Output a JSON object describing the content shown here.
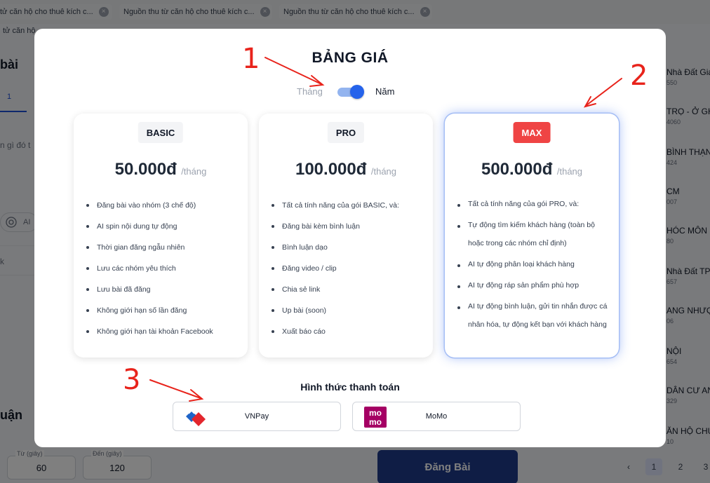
{
  "background": {
    "tabs": [
      {
        "label": "tử căn hộ cho thuê kích c..."
      },
      {
        "label": "Nguồn thu từ căn hộ cho thuê kích c..."
      },
      {
        "label": "Nguồn thu từ căn hộ cho thuê kích c..."
      }
    ],
    "subtab": "tử căn hộ",
    "left_title": "bài",
    "left_tab_label": "1",
    "left_hint": "n gì đó t",
    "left_ai_label": "AI",
    "left_k": "k",
    "left_section": "uận",
    "from_label": "Từ (giây)",
    "from_value": "60",
    "to_label": "Đến (giây)",
    "to_value": "120",
    "post_button": "Đăng Bài",
    "right_groups": [
      {
        "name": "Nhà Đất Giá",
        "sub": "550"
      },
      {
        "name": "TRỌ - Ở GHÉP",
        "sub": "4060"
      },
      {
        "name": "BÌNH THẠN",
        "sub": "424"
      },
      {
        "name": "CM",
        "sub": "007"
      },
      {
        "name": "HÓC MÔN",
        "sub": "80"
      },
      {
        "name": "Nhà Đất TP.",
        "sub": "657"
      },
      {
        "name": "ANG NHƯỢ",
        "sub": "06"
      },
      {
        "name": "NỘI",
        "sub": "654"
      },
      {
        "name": "DÂN CƯ AN",
        "sub": "329"
      },
      {
        "name": "ĂN HỘ CHU",
        "sub": "10"
      }
    ],
    "pagination": [
      "1",
      "2",
      "3"
    ]
  },
  "modal": {
    "title": "BẢNG GIÁ",
    "toggle": {
      "month_label": "Tháng",
      "year_label": "Năm",
      "selected": "year"
    },
    "plans": [
      {
        "name": "BASIC",
        "price": "50.000đ",
        "period": "/tháng",
        "features": [
          "Đăng bài vào nhóm (3 chế độ)",
          "AI spin nội dung tự động",
          "Thời gian đăng ngẫu nhiên",
          "Lưu các nhóm yêu thích",
          "Lưu bài đã đăng",
          "Không giới hạn số lần đăng",
          "Không giới hạn tài khoản Facebook"
        ]
      },
      {
        "name": "PRO",
        "price": "100.000đ",
        "period": "/tháng",
        "features": [
          "Tất cả tính năng của gói BASIC, và:",
          "Đăng bài kèm bình luận",
          "Bình luận dạo",
          "Đăng video / clip",
          "Chia sẻ link",
          "Up bài (soon)",
          "Xuất báo cáo"
        ]
      },
      {
        "name": "MAX",
        "price": "500.000đ",
        "period": "/tháng",
        "badge_color": "#ef4444",
        "features": [
          "Tất cả tính năng của gói PRO, và:",
          "Tự động tìm kiếm khách hàng (toàn bộ hoặc trong các nhóm chỉ định)",
          "AI tự động phân loại khách hàng",
          "AI tự động ráp sản phẩm phù hợp",
          "AI tự động bình luận, gửi tin nhắn được cá nhân hóa, tự động kết bạn với khách hàng"
        ]
      }
    ],
    "payment": {
      "title": "Hình thức thanh toán",
      "methods": [
        {
          "name": "VNPay",
          "icon": "vnpay-logo"
        },
        {
          "name": "MoMo",
          "icon": "momo-logo"
        }
      ]
    }
  },
  "annotations": {
    "numbers": [
      "1",
      "2",
      "3"
    ],
    "color": "#e8231b"
  },
  "colors": {
    "accent": "#2563eb",
    "max_badge": "#ef4444",
    "post_button": "#1e3a8a"
  }
}
